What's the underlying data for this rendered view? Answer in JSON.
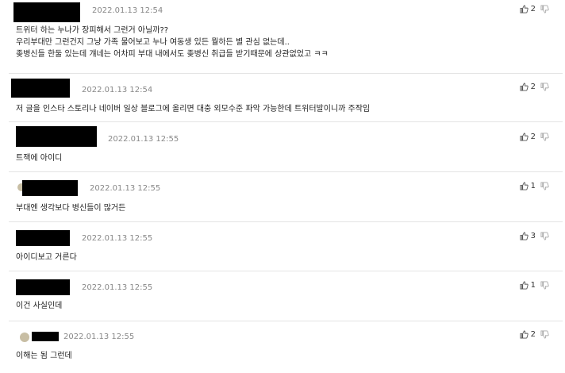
{
  "comments": [
    {
      "timestamp": "2022.01.13 12:54",
      "text": [
        "트위터 하는 누나가 장피해서 그런거 아닐까??",
        "우리부대만 그런건지 그냥 가족 물어보고 누나 여동생 있든 뭘하든 별 관심 없는데..",
        "좆병신들 한둘 있는데 걔네는 어차피 부대 내에서도 좆병신 취급들 받기때문에 상관없었고 ㅋㅋ"
      ],
      "likes": "2"
    },
    {
      "timestamp": "2022.01.13 12:54",
      "text": [
        "저 글을 인스타 스토리나 네이버 일상 블로그에 올리면 대충 외모수준 파악 가능한데 트위터발이니까 주작임"
      ],
      "likes": "2"
    },
    {
      "timestamp": "2022.01.13 12:55",
      "text": [
        "트잭에 아이디"
      ],
      "likes": "2"
    },
    {
      "timestamp": "2022.01.13 12:55",
      "text": [
        "부대엔 생각보다 병신들이 많거든"
      ],
      "likes": "1"
    },
    {
      "timestamp": "2022.01.13 12:55",
      "text": [
        "아이디보고 거른다"
      ],
      "likes": "3"
    },
    {
      "timestamp": "2022.01.13 12:55",
      "text": [
        "이건 사실인데"
      ],
      "likes": "1"
    },
    {
      "timestamp": "2022.01.13 12:55",
      "text": [
        "이해는 됨 그런데"
      ],
      "likes": "2"
    }
  ],
  "icons": {
    "like": "thumbs-up-icon",
    "dislike": "thumbs-down-icon"
  },
  "colors": {
    "redaction": "#000000",
    "timestamp": "#888888",
    "divider": "#e4e4e4"
  }
}
